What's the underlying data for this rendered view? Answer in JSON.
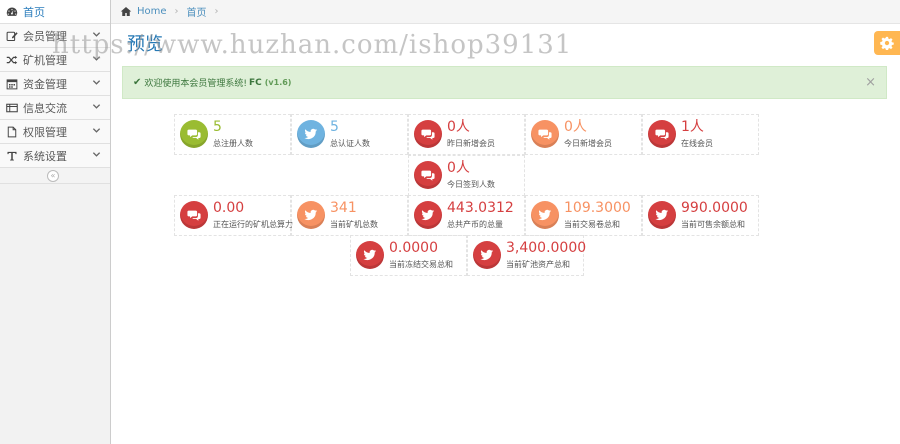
{
  "sidebar": {
    "items": [
      {
        "label": "首页",
        "icon": "dashboard-icon",
        "has_chevron": false
      },
      {
        "label": "会员管理",
        "icon": "edit-icon",
        "has_chevron": true
      },
      {
        "label": "矿机管理",
        "icon": "shuffle-icon",
        "has_chevron": true
      },
      {
        "label": "资金管理",
        "icon": "calendar-icon",
        "has_chevron": true
      },
      {
        "label": "信息交流",
        "icon": "list-icon",
        "has_chevron": true
      },
      {
        "label": "权限管理",
        "icon": "file-icon",
        "has_chevron": true
      },
      {
        "label": "系统设置",
        "icon": "text-icon",
        "has_chevron": true
      }
    ],
    "collapse_glyph": "«"
  },
  "breadcrumb": {
    "home": "Home",
    "current": "首页",
    "sep": "›"
  },
  "watermark": "https://www.huzhan.com/ishop39131",
  "page": {
    "title": "预览"
  },
  "alert": {
    "text": "欢迎使用本会员管理系统!",
    "brand": "FC",
    "version": "(v1.6)",
    "close": "×"
  },
  "stats": [
    {
      "value": "5",
      "label": "总注册人数",
      "color": "green",
      "icon": "comments-icon"
    },
    {
      "value": "5",
      "label": "总认证人数",
      "color": "blue",
      "icon": "twitter-icon"
    },
    {
      "value": "0人",
      "label": "昨日新增会员",
      "color": "red",
      "icon": "comments-icon"
    },
    {
      "value": "0人",
      "label": "今日新增会员",
      "color": "orange",
      "icon": "comments-icon"
    },
    {
      "value": "1人",
      "label": "在线会员",
      "color": "red",
      "icon": "comments-icon"
    },
    {
      "value": "0人",
      "label": "今日签到人数",
      "color": "red",
      "icon": "comments-icon"
    },
    {
      "value": "0.00",
      "label": "正在运行的矿机总算力",
      "color": "red",
      "icon": "comments-icon"
    },
    {
      "value": "341",
      "label": "当前矿机总数",
      "color": "orange",
      "icon": "twitter-icon"
    },
    {
      "value": "443.0312",
      "label": "总共产币的总量",
      "color": "red",
      "icon": "twitter-icon"
    },
    {
      "value": "109.3000",
      "label": "当前交易卷总和",
      "color": "orange",
      "icon": "twitter-icon"
    },
    {
      "value": "990.0000",
      "label": "当前可售余额总和",
      "color": "red",
      "icon": "twitter-icon"
    },
    {
      "value": "0.0000",
      "label": "当前冻结交易总和",
      "color": "red",
      "icon": "twitter-icon"
    },
    {
      "value": "3,400.0000",
      "label": "当前矿池资产总和",
      "color": "red",
      "icon": "twitter-icon"
    }
  ]
}
